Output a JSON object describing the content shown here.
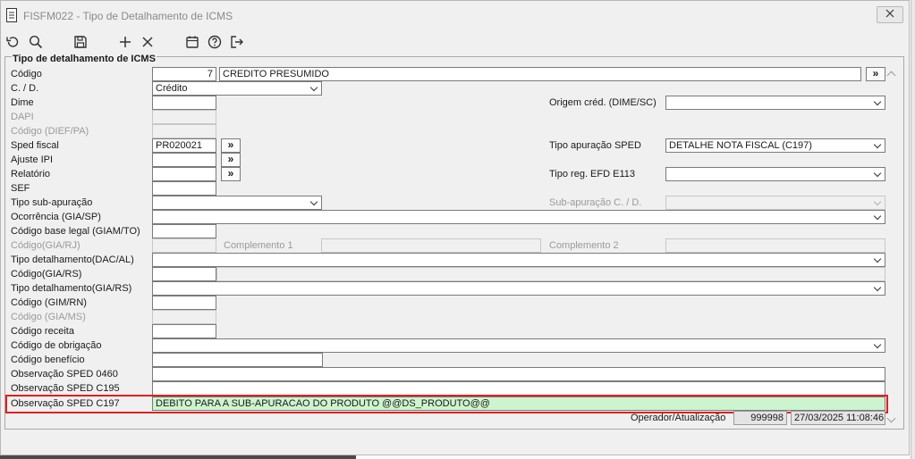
{
  "window": {
    "title": "FISFM022 - Tipo de Detalhamento de ICMS"
  },
  "panel": {
    "title": "Tipo de detalhamento de ICMS"
  },
  "labels": {
    "codigo": "Código",
    "cd": "C. / D.",
    "dime": "Dime",
    "dapi": "DAPI",
    "codigo_dief": "Código (DIEF/PA)",
    "sped_fiscal": "Sped fiscal",
    "ajuste_ipi": "Ajuste IPI",
    "relatorio": "Relatório",
    "sef": "SEF",
    "tipo_sub_apuracao": "Tipo sub-apuração",
    "ocorrencia": "Ocorrência (GIA/SP)",
    "codigo_base_legal": "Código base legal (GIAM/TO)",
    "codigo_gia_rj": "Código(GIA/RJ)",
    "tipo_det_dac": "Tipo detalhamento(DAC/AL)",
    "codigo_gia_rs": "Código(GIA/RS)",
    "tipo_det_gia_rs": "Tipo detalhamento(GIA/RS)",
    "codigo_gim_rn": "Código (GIM/RN)",
    "codigo_gia_ms": "Código (GIA/MS)",
    "codigo_receita": "Código receita",
    "codigo_obrigacao": "Código de obrigação",
    "codigo_beneficio": "Código benefício",
    "obs_0460": "Observação SPED 0460",
    "obs_c195": "Observação SPED C195",
    "obs_c197": "Observação SPED C197",
    "origem_cred": "Origem créd. (DIME/SC)",
    "tipo_apuracao_sped": "Tipo apuração SPED",
    "tipo_reg_efd": "Tipo reg. EFD E113",
    "sub_apuracao_cd": "Sub-apuração C. / D.",
    "complemento1": "Complemento 1",
    "complemento2": "Complemento 2",
    "operador": "Operador/Atualização"
  },
  "values": {
    "codigo": "7",
    "descricao": "CREDITO PRESUMIDO",
    "cd": "Crédito",
    "sped_fiscal": "PR020021",
    "tipo_apuracao_sped": "DETALHE NOTA FISCAL (C197)",
    "obs_c197": "DEBITO PARA A SUB-APURACAO DO PRODUTO @@DS_PRODUTO@@",
    "operador": "999998",
    "atualizacao": "27/03/2025 11:08:46"
  },
  "buttons": {
    "lookup": "»"
  },
  "toolbar": [
    "undo-icon",
    "search-icon",
    "save-icon",
    "add-icon",
    "delete-icon",
    "calendar-icon",
    "help-icon",
    "exit-icon"
  ],
  "colors": {
    "highlight_border": "#e41e1e",
    "highlight_fill": "#ccf5cf"
  }
}
